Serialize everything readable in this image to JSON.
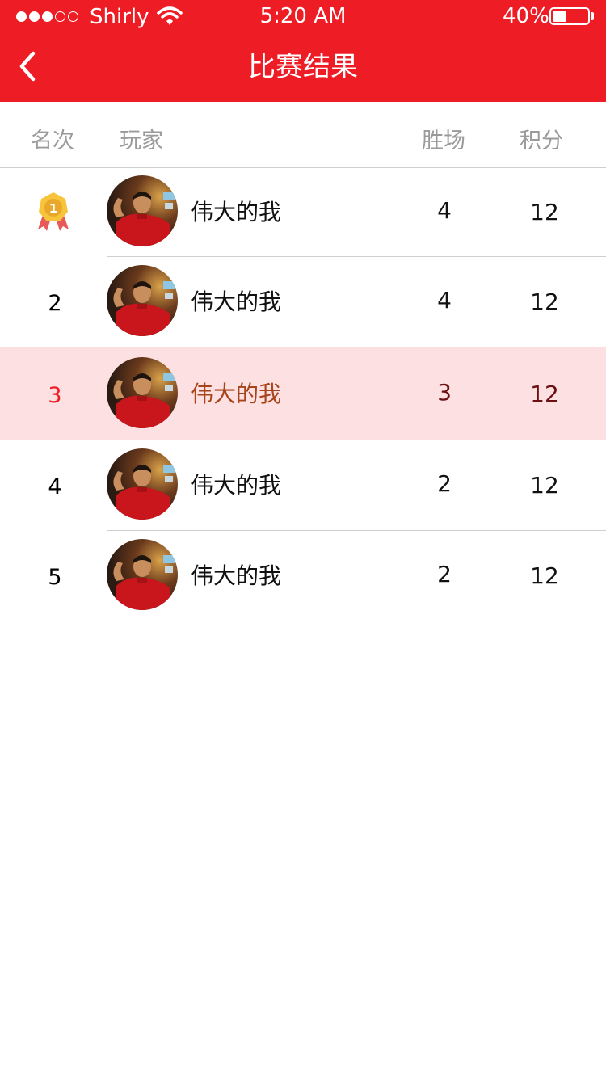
{
  "status_bar": {
    "carrier": "Shirly",
    "time": "5:20 AM",
    "battery_percent": "40%",
    "battery_level": 0.4,
    "signal_bars_filled": 3,
    "signal_bars_total": 5
  },
  "nav": {
    "title": "比赛结果",
    "back_icon": "chevron-left-icon"
  },
  "table": {
    "headers": {
      "rank": "名次",
      "player": "玩家",
      "wins": "胜场",
      "points": "积分"
    },
    "rows": [
      {
        "rank": "1",
        "rank_icon": "gold-medal-icon",
        "name": "伟大的我",
        "wins": "4",
        "points": "12",
        "highlighted": false
      },
      {
        "rank": "2",
        "name": "伟大的我",
        "wins": "4",
        "points": "12",
        "highlighted": false
      },
      {
        "rank": "3",
        "name": "伟大的我",
        "wins": "3",
        "points": "12",
        "highlighted": true
      },
      {
        "rank": "4",
        "name": "伟大的我",
        "wins": "2",
        "points": "12",
        "highlighted": false
      },
      {
        "rank": "5",
        "name": "伟大的我",
        "wins": "2",
        "points": "12",
        "highlighted": false
      }
    ]
  },
  "colors": {
    "brand_red": "#ee1c25",
    "highlight_row_bg": "#fde0e2",
    "header_text_gray": "#9a9a9a",
    "divider": "#cfcfcf"
  }
}
